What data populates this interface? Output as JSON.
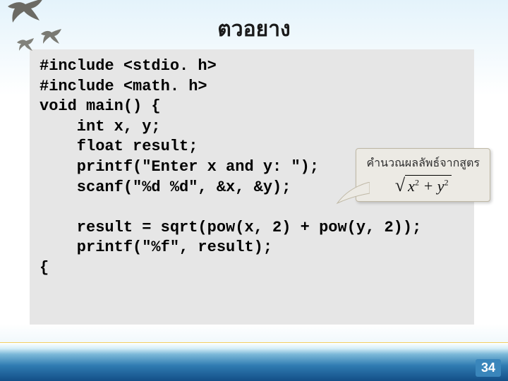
{
  "title": "ตวอยาง",
  "code": "#include <stdio. h>\n#include <math. h>\nvoid main() {\n    int x, y;\n    float result;\n    printf(\"Enter x and y: \");\n    scanf(\"%d %d\", &x, &y);\n\n    result = sqrt(pow(x, 2) + pow(y, 2));\n    printf(\"%f\", result);\n{",
  "callout": {
    "caption": "คำนวณผลลัพธ์จากสูตร",
    "formula_plain": "sqrt(x^2 + y^2)"
  },
  "page_number": "34"
}
